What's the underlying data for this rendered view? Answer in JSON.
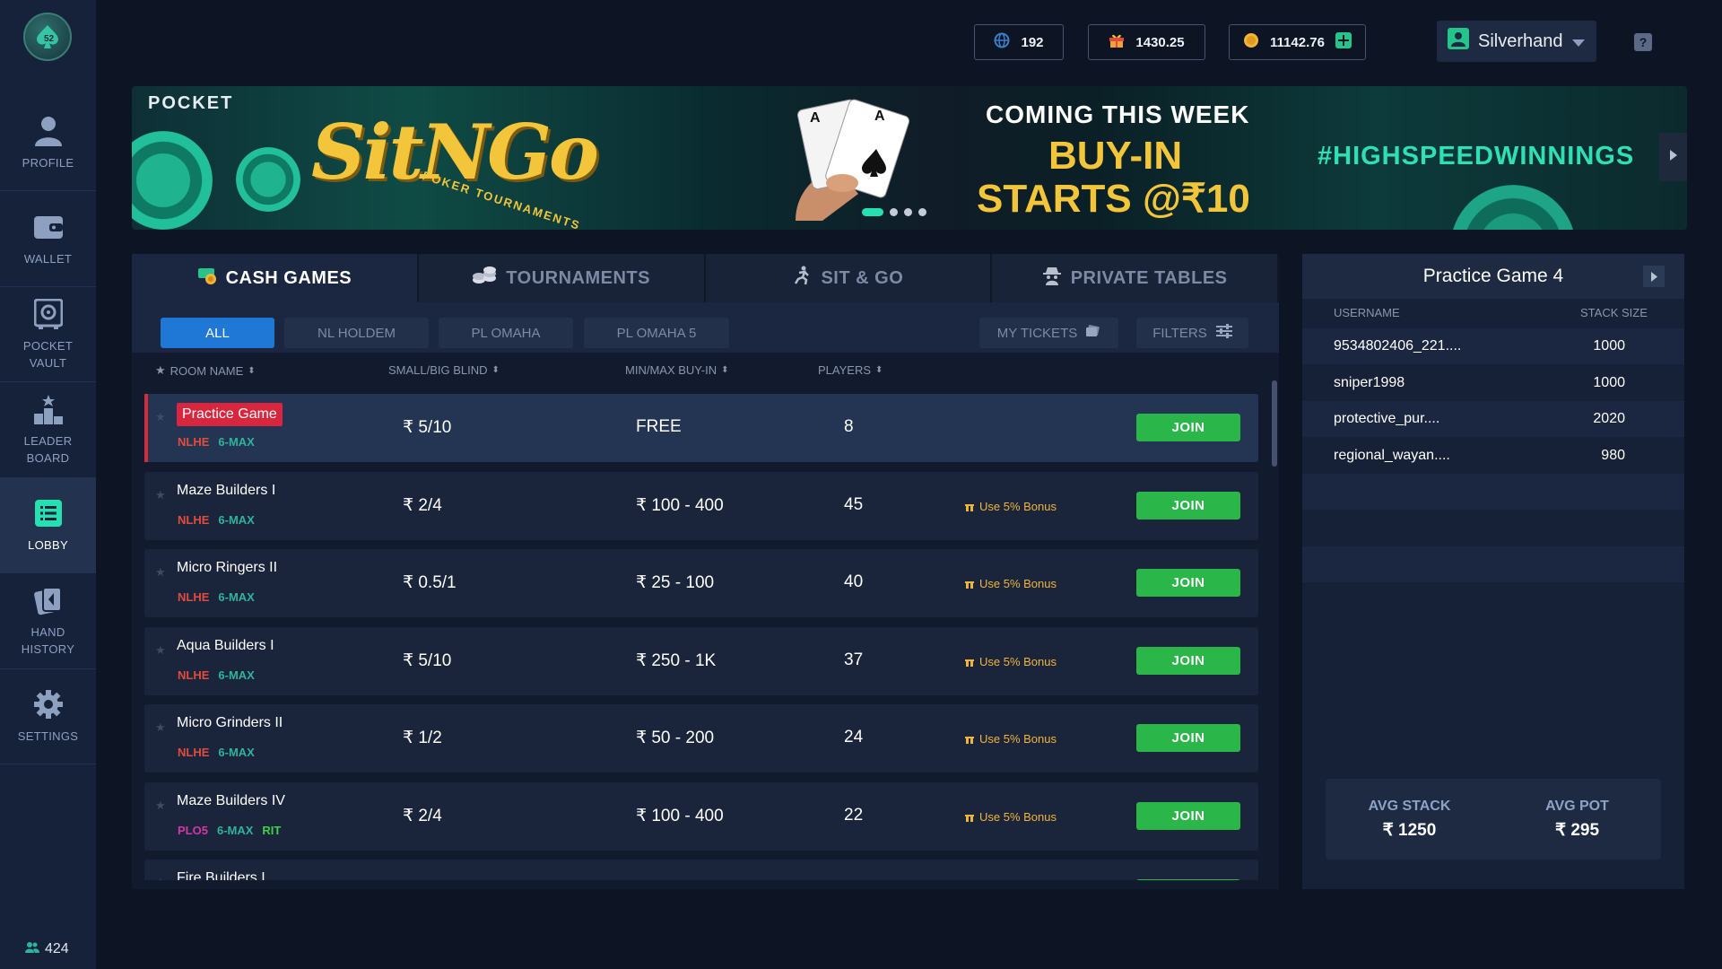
{
  "colors": {
    "accent": "#25e0b0",
    "join": "#2bb64a",
    "filter_active": "#1f77d6",
    "badge": "#d7263d",
    "bonus": "#f0b43a"
  },
  "sidebar": {
    "logo_icon": "spade-chip-logo",
    "items": [
      {
        "label": "PROFILE",
        "icon": "user-icon"
      },
      {
        "label": "WALLET",
        "icon": "wallet-icon"
      },
      {
        "label": "POCKET\nVAULT",
        "icon": "vault-icon"
      },
      {
        "label": "LEADER\nBOARD",
        "icon": "podium-icon"
      },
      {
        "label": "LOBBY",
        "icon": "list-icon",
        "active": true
      },
      {
        "label": "HAND\nHISTORY",
        "icon": "cards-icon"
      },
      {
        "label": "SETTINGS",
        "icon": "gear-icon"
      }
    ],
    "online_count": "424"
  },
  "header": {
    "tickets": "192",
    "gifts": "1430.25",
    "coins": "11142.76",
    "username": "Silverhand",
    "help_label": "?"
  },
  "banner": {
    "brand": "POCKET",
    "title": "SitNGo",
    "subtitle": "POKER TOURNAMENTS",
    "coming": "COMING THIS WEEK",
    "buyin_line1": "BUY-IN",
    "buyin_line2": "STARTS @₹10",
    "hashtag": "#HIGHSPEEDWINNINGS",
    "slides": 4,
    "active_slide": 0
  },
  "tabs": [
    {
      "label": "CASH GAMES",
      "icon": "cash-icon",
      "active": true
    },
    {
      "label": "TOURNAMENTS",
      "icon": "chips-icon"
    },
    {
      "label": "SIT & GO",
      "icon": "runner-icon"
    },
    {
      "label": "PRIVATE TABLES",
      "icon": "spy-icon"
    }
  ],
  "filters": {
    "game_types": [
      "ALL",
      "NL HOLDEM",
      "PL OMAHA",
      "PL OMAHA 5"
    ],
    "active": "ALL",
    "my_tickets": "MY TICKETS",
    "filters": "FILTERS"
  },
  "columns": {
    "room": "ROOM NAME",
    "blind": "SMALL/BIG BLIND",
    "buyin": "MIN/MAX BUY-IN",
    "players": "PLAYERS"
  },
  "rooms": [
    {
      "name": "Practice Game",
      "tags": [
        "NLHE",
        "6-MAX"
      ],
      "blind": "₹ 5/10",
      "buyin": "FREE",
      "players": "8",
      "bonus": "",
      "join": "JOIN",
      "selected": true
    },
    {
      "name": "Maze Builders I",
      "tags": [
        "NLHE",
        "6-MAX"
      ],
      "blind": "₹ 2/4",
      "buyin": "₹ 100 - 400",
      "players": "45",
      "bonus": "Use 5% Bonus",
      "join": "JOIN"
    },
    {
      "name": "Micro Ringers II",
      "tags": [
        "NLHE",
        "6-MAX"
      ],
      "blind": "₹ 0.5/1",
      "buyin": "₹ 25 - 100",
      "players": "40",
      "bonus": "Use 5% Bonus",
      "join": "JOIN"
    },
    {
      "name": "Aqua Builders I",
      "tags": [
        "NLHE",
        "6-MAX"
      ],
      "blind": "₹ 5/10",
      "buyin": "₹ 250 - 1K",
      "players": "37",
      "bonus": "Use 5% Bonus",
      "join": "JOIN"
    },
    {
      "name": "Micro Grinders II",
      "tags": [
        "NLHE",
        "6-MAX"
      ],
      "blind": "₹ 1/2",
      "buyin": "₹ 50 - 200",
      "players": "24",
      "bonus": "Use 5% Bonus",
      "join": "JOIN"
    },
    {
      "name": "Maze Builders IV",
      "tags": [
        "PLO5",
        "6-MAX",
        "RIT"
      ],
      "blind": "₹ 2/4",
      "buyin": "₹ 100 - 400",
      "players": "22",
      "bonus": "Use 5% Bonus",
      "join": "JOIN"
    },
    {
      "name": "Fire Builders I",
      "tags": [],
      "blind": "",
      "buyin": "",
      "players": "",
      "bonus": "",
      "join": ""
    }
  ],
  "side": {
    "title": "Practice Game 4",
    "col_user": "USERNAME",
    "col_stack": "STACK SIZE",
    "players": [
      {
        "name": "9534802406_221....",
        "stack": "1000"
      },
      {
        "name": "sniper1998",
        "stack": "1000"
      },
      {
        "name": "protective_pur....",
        "stack": "2020"
      },
      {
        "name": "regional_wayan....",
        "stack": "980"
      }
    ],
    "avg_stack_label": "AVG STACK",
    "avg_stack": "₹ 1250",
    "avg_pot_label": "AVG POT",
    "avg_pot": "₹ 295"
  }
}
